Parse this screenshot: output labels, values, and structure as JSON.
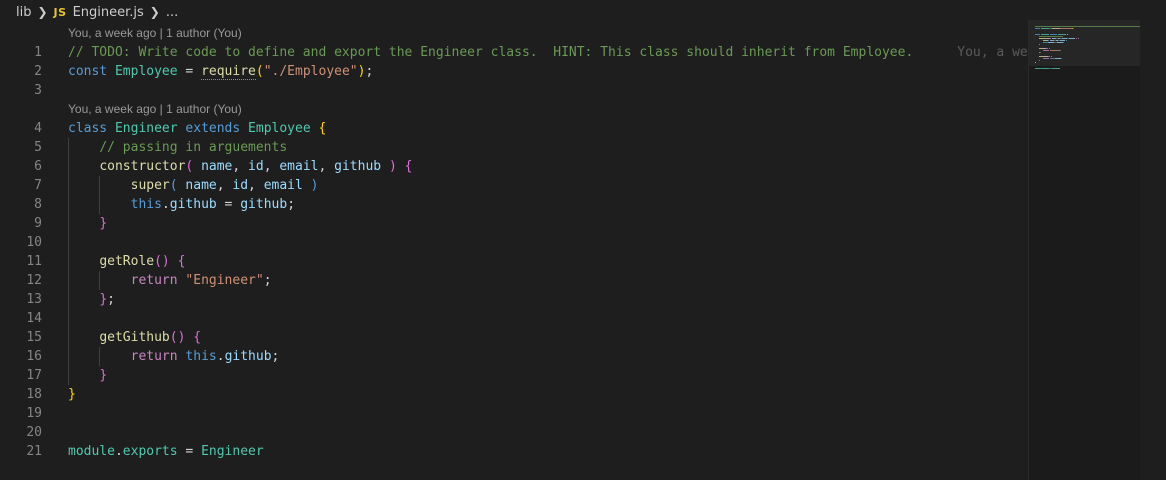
{
  "breadcrumb": {
    "folder": "lib",
    "file_badge": "JS",
    "file_name": "Engineer.js",
    "trailing": "..."
  },
  "codelens": [
    {
      "text": "You, a week ago | 1 author (You)",
      "before_line": 1
    },
    {
      "text": "You, a week ago | 1 author (You)",
      "before_line": 4
    }
  ],
  "inline_blame": "You, a week ago",
  "colors": {
    "background": "#1e1e1e",
    "comment": "#6a9955",
    "keyword_blue": "#569cd6",
    "keyword_control": "#c586c0",
    "class_name": "#4ec9b0",
    "function": "#dcdcaa",
    "variable": "#9cdcfe",
    "string": "#ce9178",
    "bracket_gold": "#ffd700",
    "bracket_purple": "#da70d6",
    "line_number": "#858585"
  },
  "lines": [
    {
      "num": "1",
      "tokens": [
        {
          "t": "// TODO: Write code to define and export the Engineer class.  HINT: This class should inherit from Employee.",
          "c": "comment"
        }
      ]
    },
    {
      "num": "2",
      "tokens": [
        {
          "t": "const",
          "c": "keyword_blue"
        },
        {
          "t": " ",
          "c": "plain"
        },
        {
          "t": "Employee",
          "c": "class_name"
        },
        {
          "t": " = ",
          "c": "plain"
        },
        {
          "t": "require",
          "c": "function",
          "squiggle": true
        },
        {
          "t": "(",
          "c": "bracket_gold"
        },
        {
          "t": "\"./Employee\"",
          "c": "string"
        },
        {
          "t": ")",
          "c": "bracket_gold"
        },
        {
          "t": ";",
          "c": "plain"
        }
      ]
    },
    {
      "num": "3",
      "tokens": []
    },
    {
      "num": "4",
      "tokens": [
        {
          "t": "class",
          "c": "keyword_blue"
        },
        {
          "t": " ",
          "c": "plain"
        },
        {
          "t": "Engineer",
          "c": "class_name"
        },
        {
          "t": " ",
          "c": "plain"
        },
        {
          "t": "extends",
          "c": "keyword_blue"
        },
        {
          "t": " ",
          "c": "plain"
        },
        {
          "t": "Employee",
          "c": "class_name"
        },
        {
          "t": " ",
          "c": "plain"
        },
        {
          "t": "{",
          "c": "bracket_gold"
        }
      ]
    },
    {
      "num": "5",
      "tokens": [
        {
          "t": "    ",
          "c": "plain"
        },
        {
          "t": "// passing in arguements",
          "c": "comment"
        }
      ]
    },
    {
      "num": "6",
      "tokens": [
        {
          "t": "    ",
          "c": "plain"
        },
        {
          "t": "constructor",
          "c": "function"
        },
        {
          "t": "(",
          "c": "bracket_purple"
        },
        {
          "t": " ",
          "c": "plain"
        },
        {
          "t": "name",
          "c": "variable"
        },
        {
          "t": ", ",
          "c": "plain"
        },
        {
          "t": "id",
          "c": "variable"
        },
        {
          "t": ", ",
          "c": "plain"
        },
        {
          "t": "email",
          "c": "variable"
        },
        {
          "t": ", ",
          "c": "plain"
        },
        {
          "t": "github",
          "c": "variable"
        },
        {
          "t": " ",
          "c": "plain"
        },
        {
          "t": ")",
          "c": "bracket_purple"
        },
        {
          "t": " ",
          "c": "plain"
        },
        {
          "t": "{",
          "c": "bracket_purple"
        }
      ]
    },
    {
      "num": "7",
      "tokens": [
        {
          "t": "        ",
          "c": "plain"
        },
        {
          "t": "super",
          "c": "function"
        },
        {
          "t": "(",
          "c": "keyword_blue"
        },
        {
          "t": " ",
          "c": "plain"
        },
        {
          "t": "name",
          "c": "variable"
        },
        {
          "t": ", ",
          "c": "plain"
        },
        {
          "t": "id",
          "c": "variable"
        },
        {
          "t": ", ",
          "c": "plain"
        },
        {
          "t": "email",
          "c": "variable"
        },
        {
          "t": " ",
          "c": "plain"
        },
        {
          "t": ")",
          "c": "keyword_blue"
        }
      ]
    },
    {
      "num": "8",
      "tokens": [
        {
          "t": "        ",
          "c": "plain"
        },
        {
          "t": "this",
          "c": "keyword_blue"
        },
        {
          "t": ".",
          "c": "plain"
        },
        {
          "t": "github",
          "c": "variable"
        },
        {
          "t": " = ",
          "c": "plain"
        },
        {
          "t": "github",
          "c": "variable"
        },
        {
          "t": ";",
          "c": "plain"
        }
      ]
    },
    {
      "num": "9",
      "tokens": [
        {
          "t": "    ",
          "c": "plain"
        },
        {
          "t": "}",
          "c": "bracket_purple"
        }
      ]
    },
    {
      "num": "10",
      "tokens": []
    },
    {
      "num": "11",
      "tokens": [
        {
          "t": "    ",
          "c": "plain"
        },
        {
          "t": "getRole",
          "c": "function"
        },
        {
          "t": "()",
          "c": "bracket_purple"
        },
        {
          "t": " ",
          "c": "plain"
        },
        {
          "t": "{",
          "c": "bracket_purple"
        }
      ]
    },
    {
      "num": "12",
      "tokens": [
        {
          "t": "        ",
          "c": "plain"
        },
        {
          "t": "return",
          "c": "keyword_control"
        },
        {
          "t": " ",
          "c": "plain"
        },
        {
          "t": "\"Engineer\"",
          "c": "string"
        },
        {
          "t": ";",
          "c": "plain"
        }
      ]
    },
    {
      "num": "13",
      "tokens": [
        {
          "t": "    ",
          "c": "plain"
        },
        {
          "t": "}",
          "c": "bracket_purple"
        },
        {
          "t": ";",
          "c": "plain"
        }
      ]
    },
    {
      "num": "14",
      "tokens": []
    },
    {
      "num": "15",
      "tokens": [
        {
          "t": "    ",
          "c": "plain"
        },
        {
          "t": "getGithub",
          "c": "function"
        },
        {
          "t": "()",
          "c": "bracket_purple"
        },
        {
          "t": " ",
          "c": "plain"
        },
        {
          "t": "{",
          "c": "bracket_purple"
        }
      ]
    },
    {
      "num": "16",
      "tokens": [
        {
          "t": "        ",
          "c": "plain"
        },
        {
          "t": "return",
          "c": "keyword_control"
        },
        {
          "t": " ",
          "c": "plain"
        },
        {
          "t": "this",
          "c": "keyword_blue"
        },
        {
          "t": ".",
          "c": "plain"
        },
        {
          "t": "github",
          "c": "variable"
        },
        {
          "t": ";",
          "c": "plain"
        }
      ]
    },
    {
      "num": "17",
      "tokens": [
        {
          "t": "    ",
          "c": "plain"
        },
        {
          "t": "}",
          "c": "bracket_purple"
        }
      ]
    },
    {
      "num": "18",
      "tokens": [
        {
          "t": "}",
          "c": "bracket_gold"
        }
      ]
    },
    {
      "num": "19",
      "tokens": []
    },
    {
      "num": "20",
      "tokens": []
    },
    {
      "num": "21",
      "tokens": [
        {
          "t": "module",
          "c": "class_name"
        },
        {
          "t": ".",
          "c": "plain"
        },
        {
          "t": "exports",
          "c": "class_name"
        },
        {
          "t": " = ",
          "c": "plain"
        },
        {
          "t": "Engineer",
          "c": "class_name"
        }
      ]
    }
  ]
}
